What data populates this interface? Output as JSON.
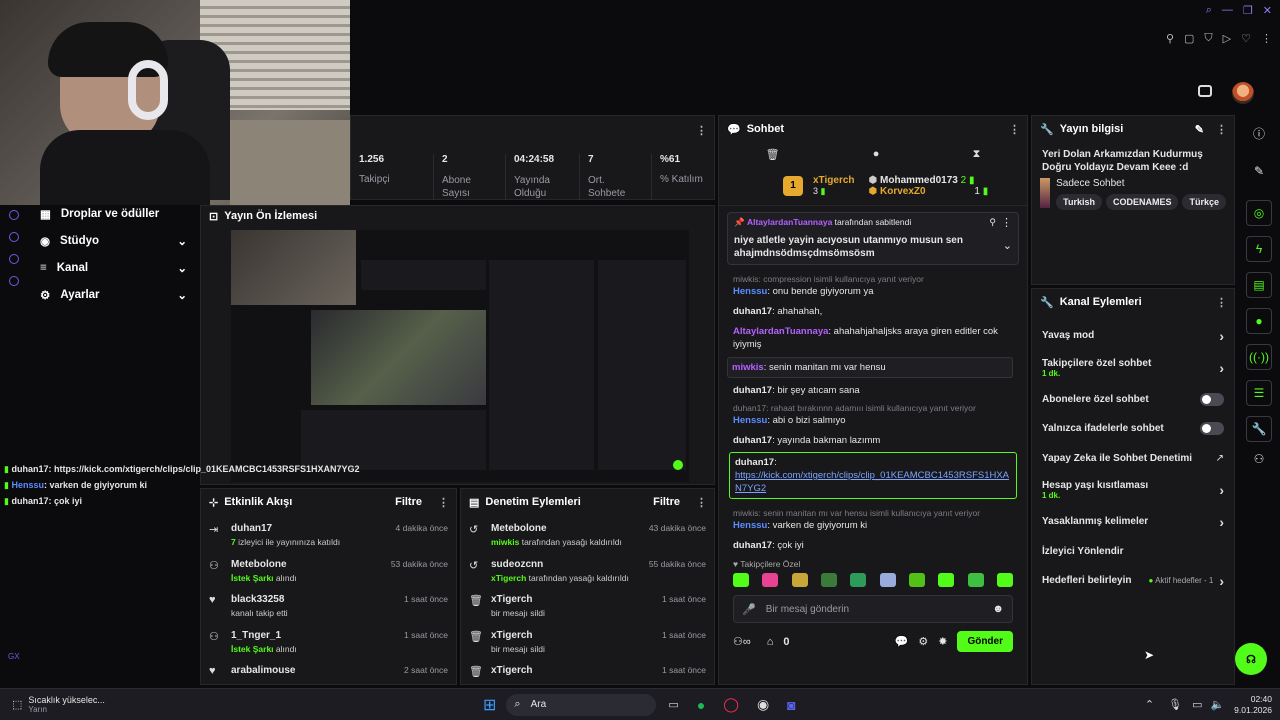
{
  "stats": [
    {
      "value": "1.256",
      "label": "Takipçi"
    },
    {
      "value": "2",
      "label": "Abone Sayısı"
    },
    {
      "value": "04:24:58",
      "label": "Yayında Olduğu"
    },
    {
      "value": "7",
      "label": "Ort. Sohbete"
    },
    {
      "value": "%61",
      "label": "% Katılım"
    }
  ],
  "sidebar": {
    "items": [
      {
        "label": "Droplar ve ödüller",
        "icon": "gift-icon"
      },
      {
        "label": "Stüdyo",
        "icon": "studio-icon"
      },
      {
        "label": "Kanal",
        "icon": "channel-icon"
      },
      {
        "label": "Ayarlar",
        "icon": "gear-icon"
      }
    ]
  },
  "preview": {
    "title": "Yayın Ön İzlemesi"
  },
  "overlay_chat": [
    {
      "user": "duhan17",
      "text": ": https://kick.com/xtigerch/clips/clip_01KEAMCBC1453RSFS1HXAN7YG2"
    },
    {
      "user": "Henssu",
      "text": ": varken de giyiyorum ki"
    },
    {
      "user": "duhan17",
      "text": ": çok iyi"
    }
  ],
  "activity": {
    "title": "Etkinlik Akışı",
    "filter": "Filtre",
    "items": [
      {
        "user": "duhan17",
        "time": "4 dakika önce",
        "highlight": "7",
        "rest": " izleyici ile yayınınıza katıldı"
      },
      {
        "user": "Metebolone",
        "time": "53 dakika önce",
        "highlight": "İstek Şarkı",
        "rest": " alındı"
      },
      {
        "user": "black33258",
        "time": "1 saat önce",
        "highlight": "",
        "rest": "kanalı takip etti"
      },
      {
        "user": "1_Tnger_1",
        "time": "1 saat önce",
        "highlight": "İstek Şarkı",
        "rest": " alındı"
      },
      {
        "user": "arabalimouse",
        "time": "2 saat önce",
        "highlight": "",
        "rest": ""
      }
    ]
  },
  "moderation": {
    "title": "Denetim Eylemleri",
    "filter": "Filtre",
    "items": [
      {
        "user": "Metebolone",
        "time": "43 dakika önce",
        "highlight": "miwkis",
        "rest": " tarafından yasağı kaldırıldı"
      },
      {
        "user": "sudeozcnn",
        "time": "55 dakika önce",
        "highlight": "xTigerch",
        "rest": " tarafından yasağı kaldırıldı"
      },
      {
        "user": "xTigerch",
        "time": "1 saat önce",
        "highlight": "",
        "rest": "bir mesajı sildi"
      },
      {
        "user": "xTigerch",
        "time": "1 saat önce",
        "highlight": "",
        "rest": "bir mesajı sildi"
      },
      {
        "user": "xTigerch",
        "time": "1 saat önce",
        "highlight": "",
        "rest": ""
      }
    ]
  },
  "chat": {
    "title": "Sohbet",
    "leader": {
      "rank": "1",
      "name": "xTigerch",
      "count": "3",
      "second": "Mohammed0173",
      "second_count": "2",
      "third": "KorvexZ0",
      "third_count": "1"
    },
    "pinned": {
      "by": "AltaylardanTuannaya",
      "suffix": " tarafından sabitlendi",
      "text": "niye atletle yayin acıyosun utanmıyo musun sen ahajmdnsödmsçdmsömsösm"
    },
    "messages": [
      {
        "reply": "miwkis: compression isimli kullanıcıya yanıt veriyor",
        "user": "Henssu",
        "color": "blue",
        "text": ": onu bende giyiyorum ya"
      },
      {
        "reply": "",
        "user": "duhan17",
        "color": "white",
        "text": ": ahahahah,"
      },
      {
        "reply": "",
        "user": "AltaylardanTuannaya",
        "color": "purple",
        "text": ": ahahahjahaljsks araya giren editler cok iyiymiş"
      },
      {
        "reply": "",
        "user": "miwkis",
        "color": "purple",
        "text": ": senin manitan mı var hensu",
        "boxed": true
      },
      {
        "reply": "",
        "user": "duhan17",
        "color": "white",
        "text": ": bir şey atıcam sana"
      },
      {
        "reply": "duhan17: rahaat bırakınnn adamııı isimli kullanıcıya yanıt veriyor",
        "user": "Henssu",
        "color": "blue",
        "text": ": abi o bizi salmıyo"
      },
      {
        "reply": "",
        "user": "duhan17",
        "color": "white",
        "text": ": yayında bakman lazımm"
      }
    ],
    "link_message": {
      "user": "duhan17",
      "text": "https://kick.com/xtigerch/clips/clip_01KEAMCBC1453RSFS1HXAN7YG2"
    },
    "messages2": [
      {
        "reply": "miwkis: senin manitan mı var hensu isimli kullanıcıya yanıt veriyor",
        "user": "Henssu",
        "color": "blue",
        "text": ": varken de giyiyorum ki"
      },
      {
        "reply": "",
        "user": "duhan17",
        "color": "white",
        "text": ": çok iyi"
      }
    ],
    "followers_only": "Takipçilere Özel",
    "input_placeholder": "Bir mesaj gönderin",
    "points": "0",
    "send": "Gönder"
  },
  "stream_info": {
    "title": "Yayın bilgisi",
    "stream_title": "Yeri Dolan Arkamızdan Kudurmuş Doğru Yoldayız Devam Keee :d",
    "category": "Sadece Sohbet",
    "tags": [
      "Turkish",
      "CODENAMES",
      "Türkçe"
    ]
  },
  "channel_actions": {
    "title": "Kanal Eylemleri",
    "items": [
      {
        "label": "Yavaş mod",
        "sub": "",
        "control": "chevron"
      },
      {
        "label": "Takipçilere özel sohbet",
        "sub": "1 dk.",
        "control": "chevron"
      },
      {
        "label": "Abonelere özel sohbet",
        "sub": "",
        "control": "toggle"
      },
      {
        "label": "Yalnızca ifadelerle sohbet",
        "sub": "",
        "control": "toggle"
      },
      {
        "label": "Yapay Zeka ile Sohbet Denetimi",
        "sub": "",
        "control": "external"
      },
      {
        "label": "Hesap yaşı kısıtlaması",
        "sub": "1 dk.",
        "control": "chevron"
      },
      {
        "label": "Yasaklanmış kelimeler",
        "sub": "",
        "control": "chevron"
      },
      {
        "label": "İzleyici Yönlendir",
        "sub": "",
        "control": "none"
      },
      {
        "label": "Hedefleri belirleyin",
        "sub": "",
        "control": "goals",
        "extra": "Aktif hedefler - 1"
      }
    ]
  },
  "taskbar": {
    "weather_title": "Sıcaklık yükselec...",
    "weather_sub": "Yarın",
    "search": "Ara",
    "time": "02:40",
    "date": "9.01.2026"
  },
  "colors": {
    "accent": "#53fc18",
    "panel": "#18181b",
    "background": "#0b0b0d"
  }
}
